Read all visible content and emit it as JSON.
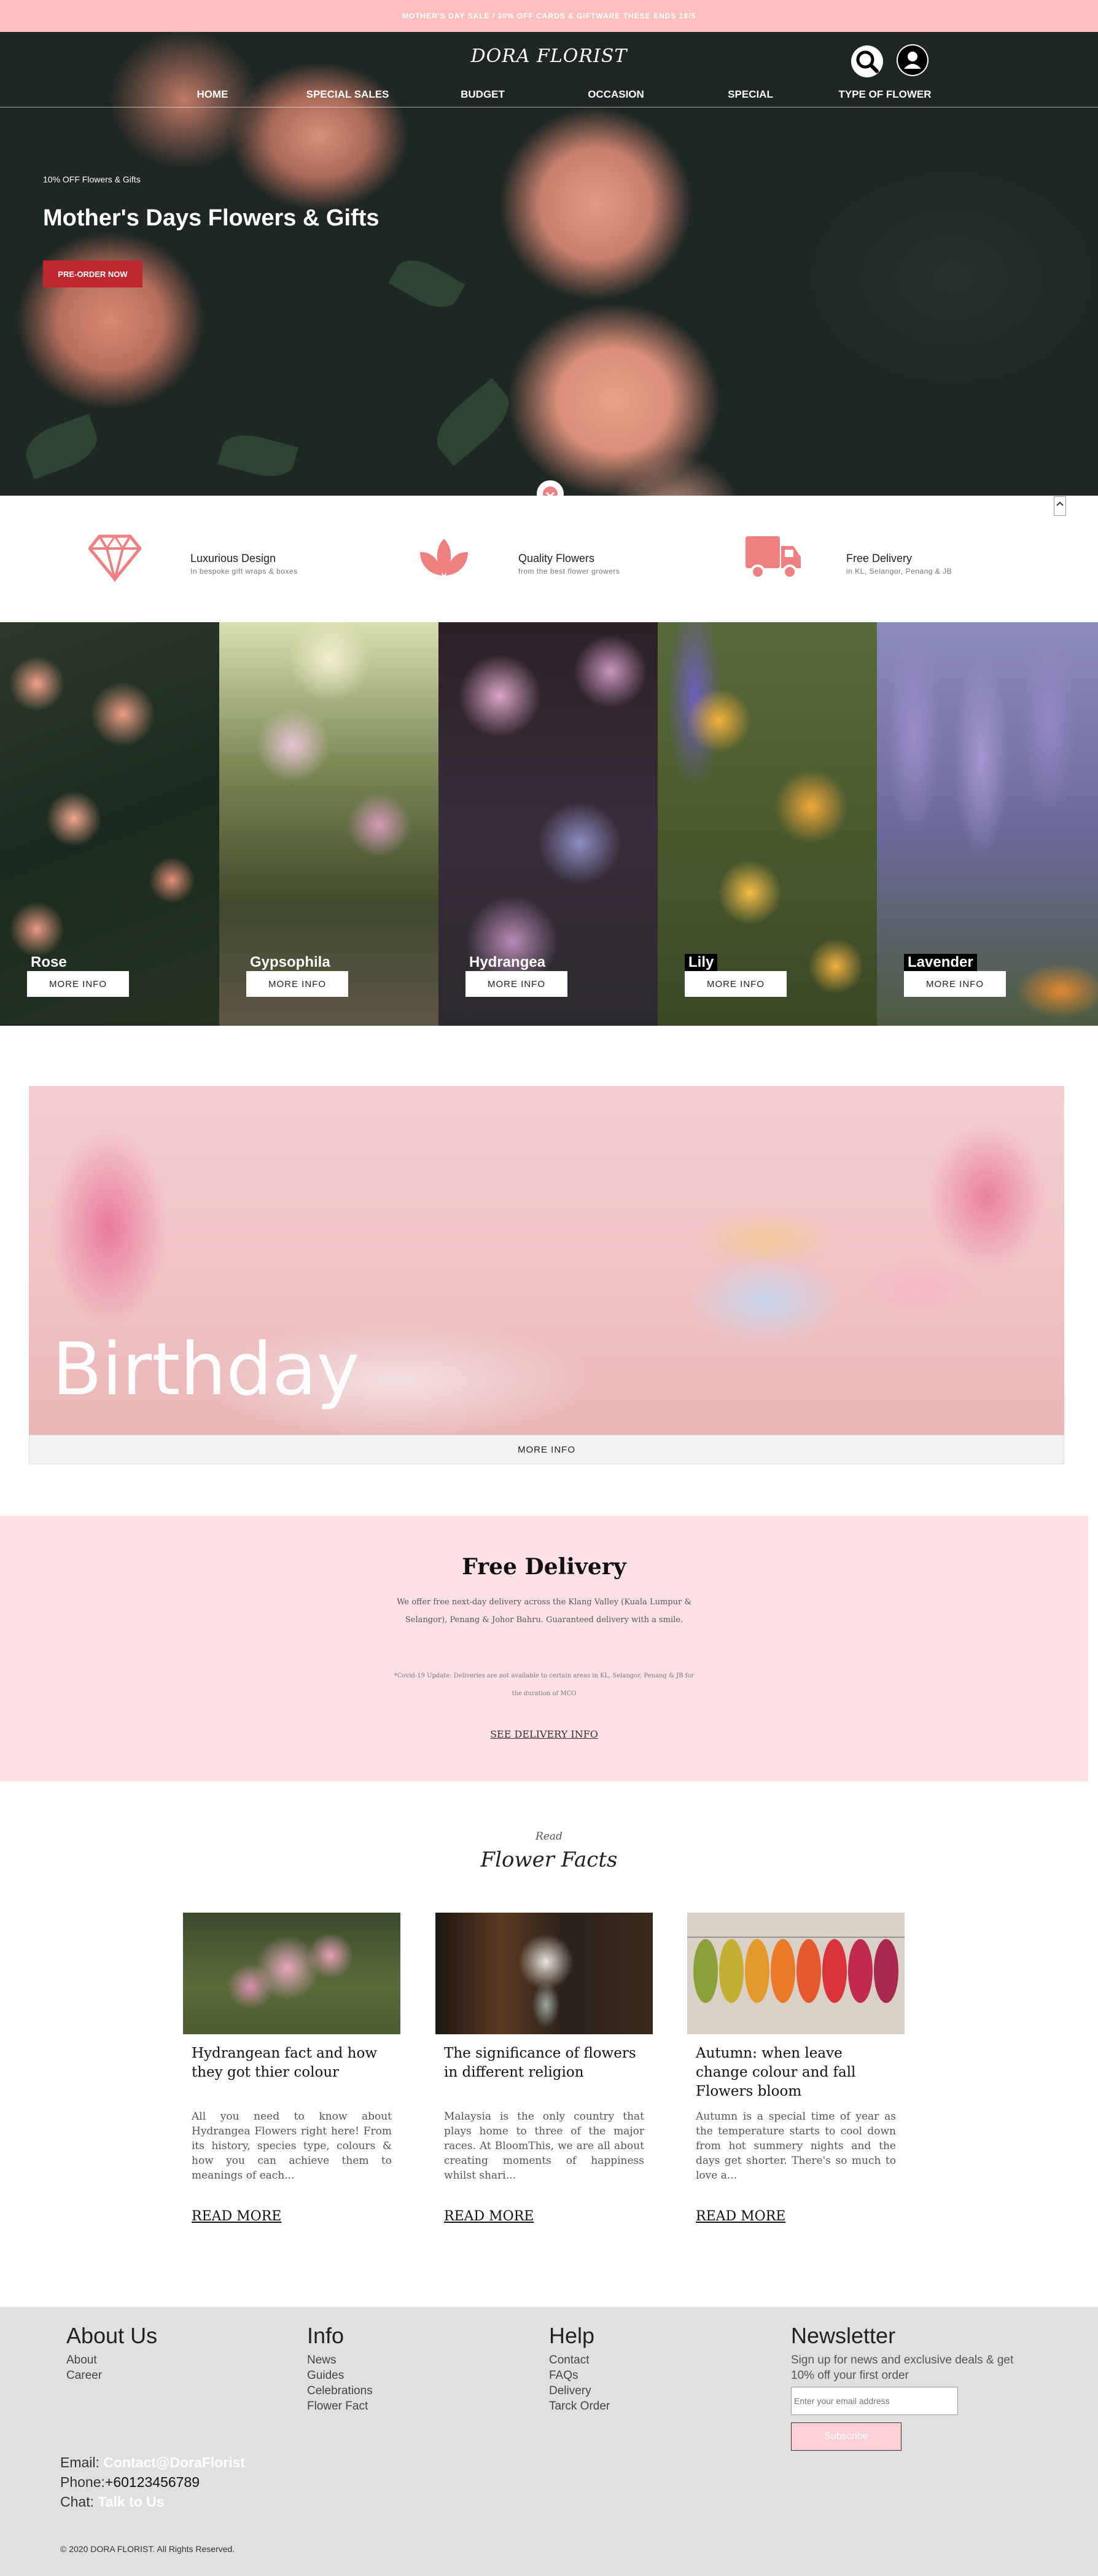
{
  "promo": {
    "text": "MOTHER'S DAY SALE / 30% OFF CARDS & GIFTWARE THESE ENDS 18/5"
  },
  "header": {
    "logo": "DORA FLORIST",
    "nav": [
      "HOME",
      "SPECIAL SALES",
      "BUDGET",
      "OCCASION",
      "SPECIAL",
      "TYPE OF FLOWER"
    ],
    "icons": [
      "search-icon",
      "user-icon"
    ]
  },
  "hero": {
    "small": "10% OFF Flowers & Gifts",
    "title": "Mother's Days Flowers & Gifts",
    "button": "PRE-ORDER NOW"
  },
  "features": [
    {
      "icon": "diamond-icon",
      "title": "Luxurious Design",
      "subtitle": "In bespoke gift wraps & boxes"
    },
    {
      "icon": "lotus-icon",
      "title": "Quality Flowers",
      "subtitle": "from the best flower growers"
    },
    {
      "icon": "truck-icon",
      "title": "Free Delivery",
      "subtitle": "in KL, Selangor, Penang & JB"
    }
  ],
  "flowers": [
    {
      "name": "Rose",
      "button": "MORE INFO"
    },
    {
      "name": "Gypsophila",
      "button": "MORE INFO"
    },
    {
      "name": "Hydrangea",
      "button": "MORE INFO"
    },
    {
      "name": "Lily",
      "button": "MORE INFO"
    },
    {
      "name": "Lavender",
      "button": "MORE INFO"
    }
  ],
  "birthday": {
    "title": "Birthday",
    "button": "MORE INFO"
  },
  "delivery": {
    "title": "Free Delivery",
    "body": "We offer free next-day delivery across the Klang Valley (Kuala Lumpur & Selangor), Penang & Johor Bahru. Guaranteed delivery with a smile.",
    "note": "*Covid-19 Update: Deliveries are not available to certain areas in KL, Selangor, Penang & JB for the duration of MCO",
    "link": "SEE DELIVERY INFO"
  },
  "facts": {
    "read": "Read",
    "title": "Flower Facts",
    "cards": [
      {
        "title": "Hydrangean fact and how they got thier colour",
        "text": "All you need to know about Hydrangea Flowers right here! From its history, species type, colours & how you can achieve them to meanings of each...",
        "link": "READ MORE"
      },
      {
        "title": "The significance of flowers in different religion",
        "text": "Malaysia is the only country that plays home to three of the major races. At BloomThis, we are all about creating moments of happiness whilst shari...",
        "link": "READ MORE"
      },
      {
        "title": "Autumn: when leave change colour and fall Flowers bloom",
        "text": "Autumn is a special time of year as the temperature starts to cool down from hot summery nights and the days get shorter. There's so much to love a...",
        "link": "READ MORE"
      }
    ]
  },
  "footer": {
    "about": {
      "title": "About Us",
      "links": [
        "About",
        "Career"
      ]
    },
    "info": {
      "title": "Info",
      "links": [
        "News",
        "Guides",
        "Celebrations",
        "Flower Fact"
      ]
    },
    "help": {
      "title": "Help",
      "links": [
        "Contact",
        "FAQs",
        "Delivery",
        "Tarck Order"
      ]
    },
    "newsletter": {
      "title": "Newsletter",
      "text": "Sign up for news and exclusive deals & get 10% off your first order",
      "placeholder": "Enter your email address",
      "button": "Subscribe"
    },
    "contact": {
      "email_label": "Email:",
      "email": "Contact@DoraFlorist",
      "phone_label": "Phone:",
      "phone": "+60123456789",
      "chat_label": "Chat:",
      "chat": "Talk to Us"
    },
    "copyright": "© 2020 DORA FLORIST. All Rights Reserved."
  },
  "colors": {
    "accent": "#ffbfbf",
    "button_red": "#c0282d",
    "icon_pink": "#f08080",
    "delivery_bg": "#fde1e4",
    "footer_bg": "#e0e0e0"
  }
}
